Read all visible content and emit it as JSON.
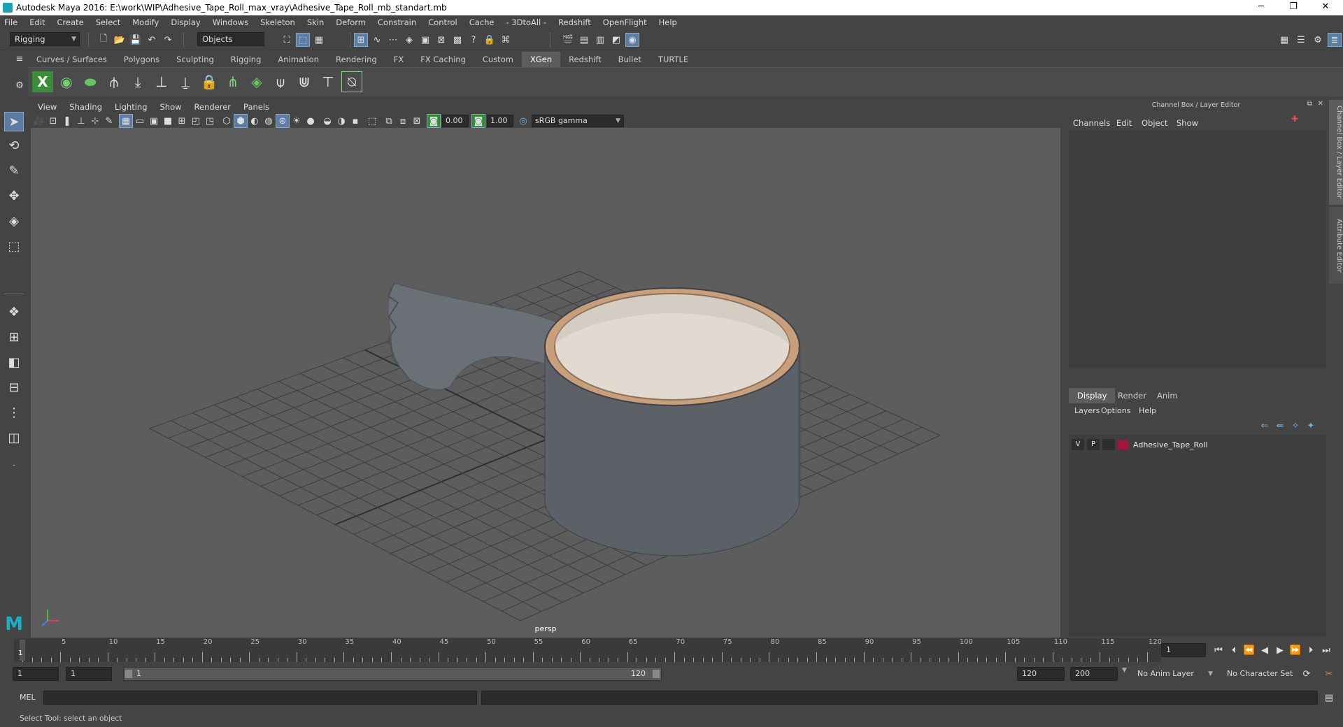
{
  "window": {
    "title": "Autodesk Maya 2016: E:\\work\\WIP\\Adhesive_Tape_Roll_max_vray\\Adhesive_Tape_Roll_mb_standart.mb",
    "minimize": "─",
    "restore": "❐",
    "close": "✕"
  },
  "menubar": [
    "File",
    "Edit",
    "Create",
    "Select",
    "Modify",
    "Display",
    "Windows",
    "Skeleton",
    "Skin",
    "Deform",
    "Constrain",
    "Control",
    "Cache",
    "- 3DtoAll -",
    "Redshift",
    "OpenFlight",
    "Help"
  ],
  "statusline": {
    "mode": "Rigging",
    "selection_mask": "Objects"
  },
  "shelf_tabs": [
    "Curves / Surfaces",
    "Polygons",
    "Sculpting",
    "Rigging",
    "Animation",
    "Rendering",
    "FX",
    "FX Caching",
    "Custom",
    "XGen",
    "Redshift",
    "Bullet",
    "TURTLE"
  ],
  "active_shelf": "XGen",
  "viewport": {
    "menu": [
      "View",
      "Shading",
      "Lighting",
      "Show",
      "Renderer",
      "Panels"
    ],
    "exposure": "0.00",
    "gamma": "1.00",
    "color_space": "sRGB gamma",
    "camera_label": "persp"
  },
  "right_panel": {
    "title": "Channel Box / Layer Editor",
    "channel_menu": [
      "Channels",
      "Edit",
      "Object",
      "Show"
    ],
    "layer_tabs": [
      "Display",
      "Render",
      "Anim"
    ],
    "active_layer_tab": "Display",
    "layer_menu": [
      "Layers",
      "Options",
      "Help"
    ],
    "layers": [
      {
        "v": "V",
        "p": "P",
        "name": "Adhesive_Tape_Roll",
        "color": "#a0163c"
      }
    ],
    "side_tabs": [
      "Channel Box / Layer Editor",
      "Attribute Editor"
    ]
  },
  "timeline": {
    "labels": [
      "5",
      "10",
      "15",
      "20",
      "25",
      "30",
      "35",
      "40",
      "45",
      "50",
      "55",
      "60",
      "65",
      "70",
      "75",
      "80",
      "85",
      "90",
      "95",
      "100",
      "105",
      "110",
      "115",
      "120"
    ],
    "first_frame": "1",
    "current_frame": "1"
  },
  "range": {
    "start": "1",
    "playback_start": "1",
    "slider_start": "1",
    "slider_end": "120",
    "playback_end": "120",
    "end": "200",
    "anim_layer": "No Anim Layer",
    "character_set": "No Character Set"
  },
  "mel": {
    "label": "MEL"
  },
  "help_line": "Select Tool: select an object"
}
